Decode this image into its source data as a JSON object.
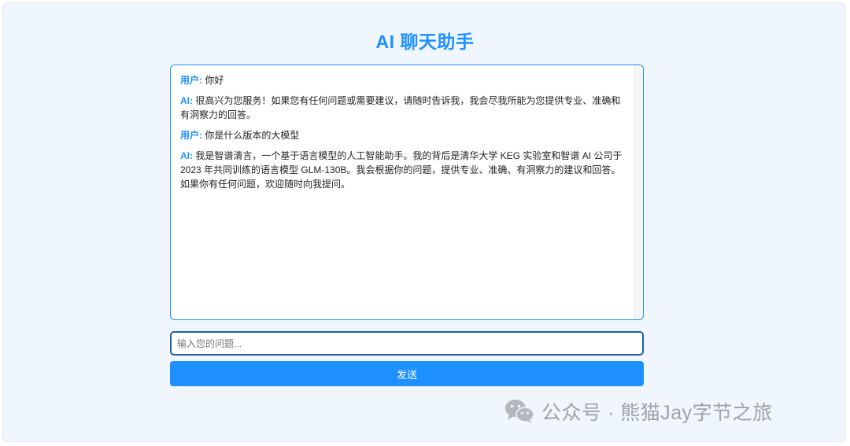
{
  "app": {
    "title": "AI 聊天助手"
  },
  "chat": {
    "messages": [
      {
        "speaker": "用户:",
        "text": "你好"
      },
      {
        "speaker": "AI:",
        "text": "很高兴为您服务！如果您有任何问题或需要建议，请随时告诉我，我会尽我所能为您提供专业、准确和有洞察力的回答。"
      },
      {
        "speaker": "用户:",
        "text": "你是什么版本的大模型"
      },
      {
        "speaker": "AI:",
        "text": "我是智谱清言，一个基于语言模型的人工智能助手。我的背后是清华大学 KEG 实验室和智谱 AI 公司于 2023 年共同训练的语言模型 GLM-130B。我会根据你的问题，提供专业、准确、有洞察力的建议和回答。如果你有任何问题，欢迎随时向我提问。"
      }
    ]
  },
  "input": {
    "placeholder": "输入您的问题...",
    "value": ""
  },
  "send_button": {
    "label": "发送"
  },
  "watermark": {
    "icon": "wechat-icon",
    "text": "公众号 · 熊猫Jay字节之旅"
  },
  "colors": {
    "accent": "#1e90ff",
    "background": "#f0f6fd",
    "input_border": "#1f5fb0"
  }
}
